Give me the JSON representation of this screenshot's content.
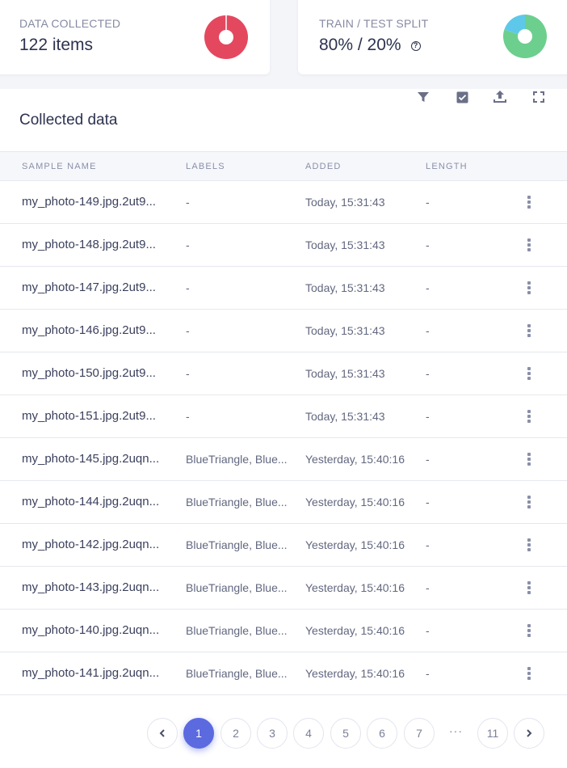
{
  "stats": {
    "collected": {
      "label": "DATA COLLECTED",
      "value": "122 items",
      "color": "#e4485f"
    },
    "split": {
      "label": "TRAIN / TEST SPLIT",
      "value": "80% / 20%",
      "help_icon": "question-circle-icon",
      "train_percent": 80,
      "test_percent": 20,
      "train_color": "#6ccf8e",
      "test_color": "#5ec8ea"
    }
  },
  "panel": {
    "title": "Collected data",
    "tools": [
      "filter-icon",
      "checkbox-icon",
      "upload-icon",
      "fullscreen-icon"
    ]
  },
  "table": {
    "headers": {
      "name": "SAMPLE NAME",
      "labels": "LABELS",
      "added": "ADDED",
      "length": "LENGTH"
    },
    "rows": [
      {
        "name": "my_photo-149.jpg.2ut9...",
        "labels": "-",
        "added": "Today, 15:31:43",
        "length": "-"
      },
      {
        "name": "my_photo-148.jpg.2ut9...",
        "labels": "-",
        "added": "Today, 15:31:43",
        "length": "-"
      },
      {
        "name": "my_photo-147.jpg.2ut9...",
        "labels": "-",
        "added": "Today, 15:31:43",
        "length": "-"
      },
      {
        "name": "my_photo-146.jpg.2ut9...",
        "labels": "-",
        "added": "Today, 15:31:43",
        "length": "-"
      },
      {
        "name": "my_photo-150.jpg.2ut9...",
        "labels": "-",
        "added": "Today, 15:31:43",
        "length": "-"
      },
      {
        "name": "my_photo-151.jpg.2ut9...",
        "labels": "-",
        "added": "Today, 15:31:43",
        "length": "-"
      },
      {
        "name": "my_photo-145.jpg.2uqn...",
        "labels": "BlueTriangle, Blue...",
        "added": "Yesterday, 15:40:16",
        "length": "-"
      },
      {
        "name": "my_photo-144.jpg.2uqn...",
        "labels": "BlueTriangle, Blue...",
        "added": "Yesterday, 15:40:16",
        "length": "-"
      },
      {
        "name": "my_photo-142.jpg.2uqn...",
        "labels": "BlueTriangle, Blue...",
        "added": "Yesterday, 15:40:16",
        "length": "-"
      },
      {
        "name": "my_photo-143.jpg.2uqn...",
        "labels": "BlueTriangle, Blue...",
        "added": "Yesterday, 15:40:16",
        "length": "-"
      },
      {
        "name": "my_photo-140.jpg.2uqn...",
        "labels": "BlueTriangle, Blue...",
        "added": "Yesterday, 15:40:16",
        "length": "-"
      },
      {
        "name": "my_photo-141.jpg.2uqn...",
        "labels": "BlueTriangle, Blue...",
        "added": "Yesterday, 15:40:16",
        "length": "-"
      }
    ]
  },
  "pagination": {
    "prev_icon": "chevron-left-icon",
    "next_icon": "chevron-right-icon",
    "pages": [
      "1",
      "2",
      "3",
      "4",
      "5",
      "6",
      "7"
    ],
    "ellipsis": "···",
    "last": "11",
    "current": "1",
    "accent": "#5c6ae0"
  }
}
